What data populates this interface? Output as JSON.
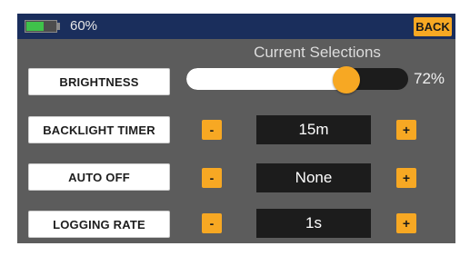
{
  "status_bar": {
    "battery_text": "60%",
    "battery_level": 0.6,
    "back_label": "BACK"
  },
  "section_title": "Current Selections",
  "settings": {
    "brightness": {
      "label": "BRIGHTNESS",
      "value_text": "72%",
      "value_fraction": 0.72
    },
    "backlight_timer": {
      "label": "BACKLIGHT TIMER",
      "value": "15m"
    },
    "auto_off": {
      "label": "AUTO OFF",
      "value": "None"
    },
    "logging_rate": {
      "label": "LOGGING RATE",
      "value": "1s"
    }
  },
  "controls": {
    "decrease_label": "-",
    "increase_label": "+"
  },
  "colors": {
    "accent": "#f7a823",
    "panel": "#5c5c5c",
    "status_bar": "#1a2e5c",
    "battery": "#3fc24a",
    "value_box": "#1c1c1c"
  }
}
